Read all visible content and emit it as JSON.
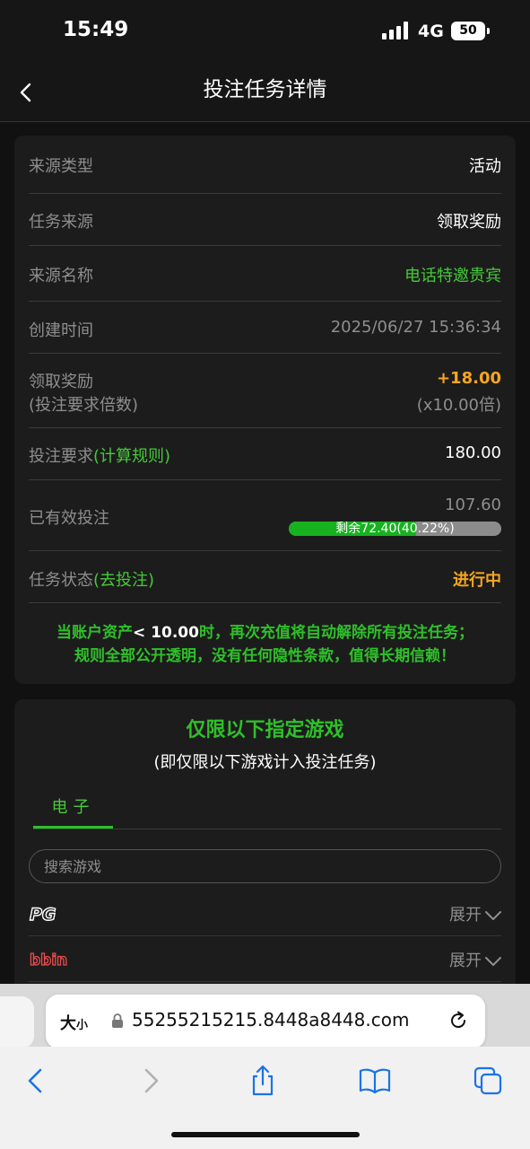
{
  "status_bar": {
    "time": "15:49",
    "network": "4G",
    "battery": "50"
  },
  "nav": {
    "title": "投注任务详情"
  },
  "details": {
    "source_type": {
      "label": "来源类型",
      "value": "活动"
    },
    "task_source": {
      "label": "任务来源",
      "value": "领取奖励"
    },
    "source_name": {
      "label": "来源名称",
      "value": "电话特邀贵宾"
    },
    "created_time": {
      "label": "创建时间",
      "value": "2025/06/27 15:36:34"
    },
    "reward": {
      "label": "领取奖励",
      "sublabel": "(投注要求倍数)",
      "value": "+18.00",
      "multiplier": "(x10.00倍)"
    },
    "bet_requirement": {
      "label": "投注要求",
      "link": "(计算规则)",
      "value": "180.00"
    },
    "valid_bet": {
      "label": "已有效投注",
      "value": "107.60",
      "progress_text": "剩余72.40(40.22%)",
      "progress_fraction": 0.5978
    },
    "task_status": {
      "label": "任务状态",
      "link": "(去投注)",
      "value": "进行中"
    }
  },
  "notice": {
    "part1": "当账户资产",
    "threshold": "< 10.00",
    "part2": "时，再次充值将自动解除所有投注任务；",
    "line2": "规则全部公开透明，没有任何隐性条款，值得长期信赖！"
  },
  "games": {
    "title": "仅限以下指定游戏",
    "subtitle": "(即仅限以下游戏计入投注任务)",
    "tab": "电子",
    "search_placeholder": "搜索游戏",
    "providers": [
      {
        "logo": "PG",
        "expand_label": "展开"
      },
      {
        "logo": "bbin",
        "expand_label": "展开"
      }
    ]
  },
  "browser": {
    "text_size": "大",
    "text_size_small": "小",
    "url": "55255215215.8448a8448.com"
  },
  "colors": {
    "accent_green": "#2fc02a",
    "orange": "#f5a623",
    "background": "#111111",
    "card": "#1c1c1c"
  }
}
